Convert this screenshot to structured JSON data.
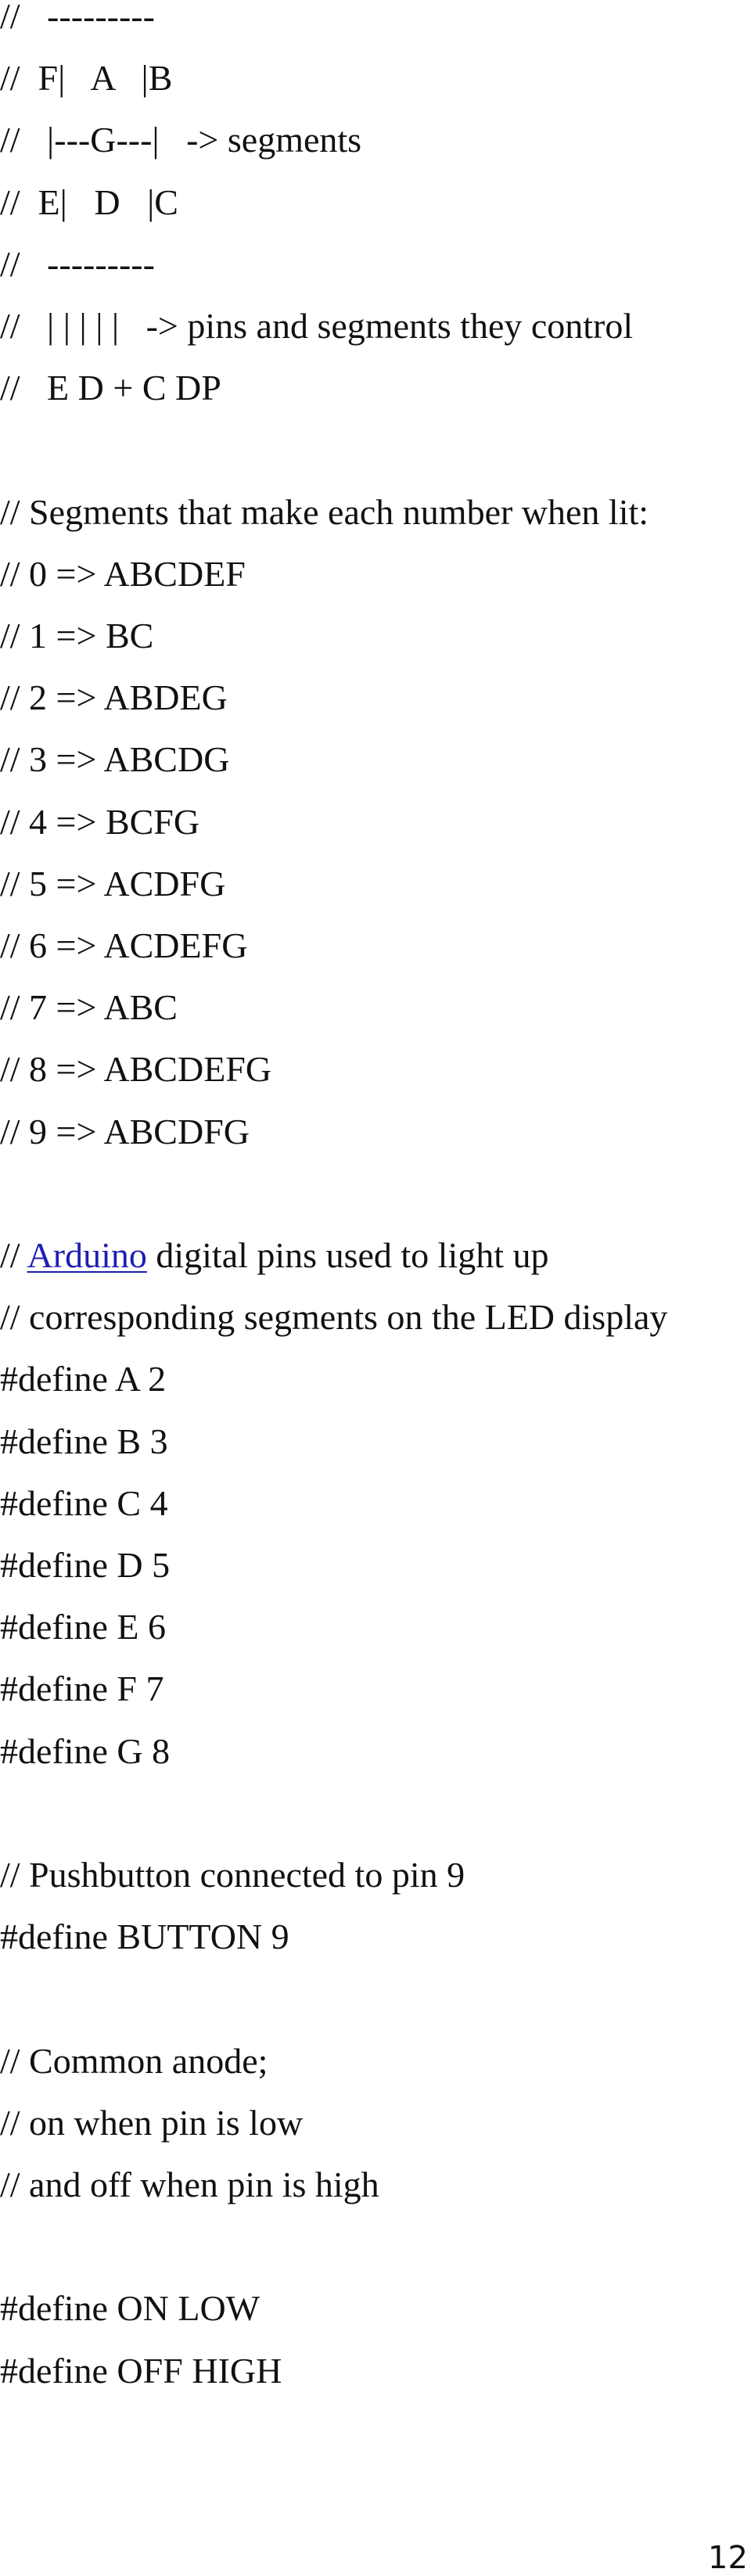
{
  "document": {
    "link_color": "#1f1fb0",
    "text_color": "#111111",
    "lines": [
      {
        "segments": [
          {
            "text": "//   ---------"
          }
        ]
      },
      {
        "segments": [
          {
            "text": "//  F|   A   |B"
          }
        ]
      },
      {
        "segments": [
          {
            "text": "//   |---G---|   -> segments"
          }
        ]
      },
      {
        "segments": [
          {
            "text": "//  E|   D   |C"
          }
        ]
      },
      {
        "segments": [
          {
            "text": "//   ---------"
          }
        ]
      },
      {
        "segments": [
          {
            "text": "//   | | | | |   -> pins and segments they control"
          }
        ]
      },
      {
        "segments": [
          {
            "text": "//   E D + C DP"
          }
        ]
      },
      {
        "segments": []
      },
      {
        "segments": [
          {
            "text": "// Segments that make each number when lit:"
          }
        ]
      },
      {
        "segments": [
          {
            "text": "// 0 => ABCDEF"
          }
        ]
      },
      {
        "segments": [
          {
            "text": "// 1 => BC"
          }
        ]
      },
      {
        "segments": [
          {
            "text": "// 2 => ABDEG"
          }
        ]
      },
      {
        "segments": [
          {
            "text": "// 3 => ABCDG"
          }
        ]
      },
      {
        "segments": [
          {
            "text": "// 4 => BCFG"
          }
        ]
      },
      {
        "segments": [
          {
            "text": "// 5 => ACDFG"
          }
        ]
      },
      {
        "segments": [
          {
            "text": "// 6 => ACDEFG"
          }
        ]
      },
      {
        "segments": [
          {
            "text": "// 7 => ABC"
          }
        ]
      },
      {
        "segments": [
          {
            "text": "// 8 => ABCDEFG"
          }
        ]
      },
      {
        "segments": [
          {
            "text": "// 9 => ABCDFG"
          }
        ]
      },
      {
        "segments": []
      },
      {
        "segments": [
          {
            "text": "// "
          },
          {
            "text": "Arduino",
            "link": true
          },
          {
            "text": " digital pins used to light up"
          }
        ]
      },
      {
        "segments": [
          {
            "text": "// corresponding segments on the LED display"
          }
        ]
      },
      {
        "segments": [
          {
            "text": "#define A 2"
          }
        ]
      },
      {
        "segments": [
          {
            "text": "#define B 3"
          }
        ]
      },
      {
        "segments": [
          {
            "text": "#define C 4"
          }
        ]
      },
      {
        "segments": [
          {
            "text": "#define D 5"
          }
        ]
      },
      {
        "segments": [
          {
            "text": "#define E 6"
          }
        ]
      },
      {
        "segments": [
          {
            "text": "#define F 7"
          }
        ]
      },
      {
        "segments": [
          {
            "text": "#define G 8"
          }
        ]
      },
      {
        "segments": []
      },
      {
        "segments": [
          {
            "text": "// Pushbutton connected to pin 9"
          }
        ]
      },
      {
        "segments": [
          {
            "text": "#define BUTTON 9"
          }
        ]
      },
      {
        "segments": []
      },
      {
        "segments": [
          {
            "text": "// Common anode;"
          }
        ]
      },
      {
        "segments": [
          {
            "text": "// on when pin is low"
          }
        ]
      },
      {
        "segments": [
          {
            "text": "// and off when pin is high"
          }
        ]
      },
      {
        "segments": []
      },
      {
        "segments": [
          {
            "text": "#define ON LOW"
          }
        ]
      },
      {
        "segments": [
          {
            "text": "#define OFF HIGH"
          }
        ]
      }
    ],
    "page_number": "12"
  }
}
